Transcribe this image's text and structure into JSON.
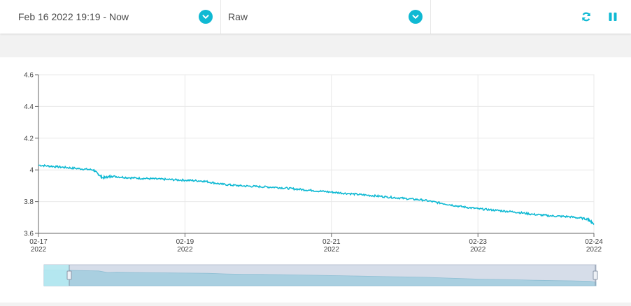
{
  "toolbar": {
    "time_range": {
      "value": "Feb 16 2022 19:19 - Now",
      "icon": "chevron-down-icon"
    },
    "mode": {
      "value": "Raw",
      "icon": "chevron-down-icon"
    },
    "actions": [
      {
        "name": "refresh",
        "icon": "refresh-icon"
      },
      {
        "name": "pause",
        "icon": "pause-icon"
      }
    ],
    "accent_color": "#0fb9d3"
  },
  "chart_data": {
    "type": "line",
    "title": "",
    "xlabel": "",
    "ylabel": "",
    "ylim": [
      3.6,
      4.6
    ],
    "y_ticks": [
      "3.6",
      "3.8",
      "4",
      "4.2",
      "4.4",
      "4.6"
    ],
    "x_ticks": [
      {
        "date": "02-17",
        "year": "2022"
      },
      {
        "date": "02-19",
        "year": "2022"
      },
      {
        "date": "02-21",
        "year": "2022"
      },
      {
        "date": "02-23",
        "year": "2022"
      },
      {
        "date": "02-24",
        "year": "2022"
      }
    ],
    "xlim": [
      "2022-02-17 00:00",
      "2022-02-24 14:00"
    ],
    "grid": true,
    "series": [
      {
        "color": "#0fb9d3",
        "x": [
          "2022-02-17 00:00",
          "2022-02-17 06:00",
          "2022-02-17 12:00",
          "2022-02-17 18:00",
          "2022-02-17 21:00",
          "2022-02-18 00:00",
          "2022-02-18 06:00",
          "2022-02-18 12:00",
          "2022-02-18 18:00",
          "2022-02-19 00:00",
          "2022-02-19 06:00",
          "2022-02-19 12:00",
          "2022-02-19 18:00",
          "2022-02-20 00:00",
          "2022-02-20 06:00",
          "2022-02-20 12:00",
          "2022-02-20 18:00",
          "2022-02-21 00:00",
          "2022-02-21 06:00",
          "2022-02-21 12:00",
          "2022-02-21 18:00",
          "2022-02-22 00:00",
          "2022-02-22 06:00",
          "2022-02-22 12:00",
          "2022-02-22 18:00",
          "2022-02-23 00:00",
          "2022-02-23 06:00",
          "2022-02-23 12:00",
          "2022-02-23 18:00",
          "2022-02-24 00:00",
          "2022-02-24 06:00",
          "2022-02-24 12:00",
          "2022-02-24 14:00"
        ],
        "y": [
          4.03,
          4.02,
          4.01,
          4.0,
          3.95,
          3.96,
          3.95,
          3.945,
          3.94,
          3.935,
          3.93,
          3.91,
          3.9,
          3.895,
          3.89,
          3.88,
          3.87,
          3.86,
          3.85,
          3.84,
          3.83,
          3.82,
          3.81,
          3.79,
          3.77,
          3.755,
          3.745,
          3.735,
          3.72,
          3.71,
          3.705,
          3.69,
          3.66
        ]
      }
    ],
    "navigator": {
      "selected_start": "2022-02-17 00:00",
      "selected_end": "2022-02-24 14:00"
    }
  }
}
